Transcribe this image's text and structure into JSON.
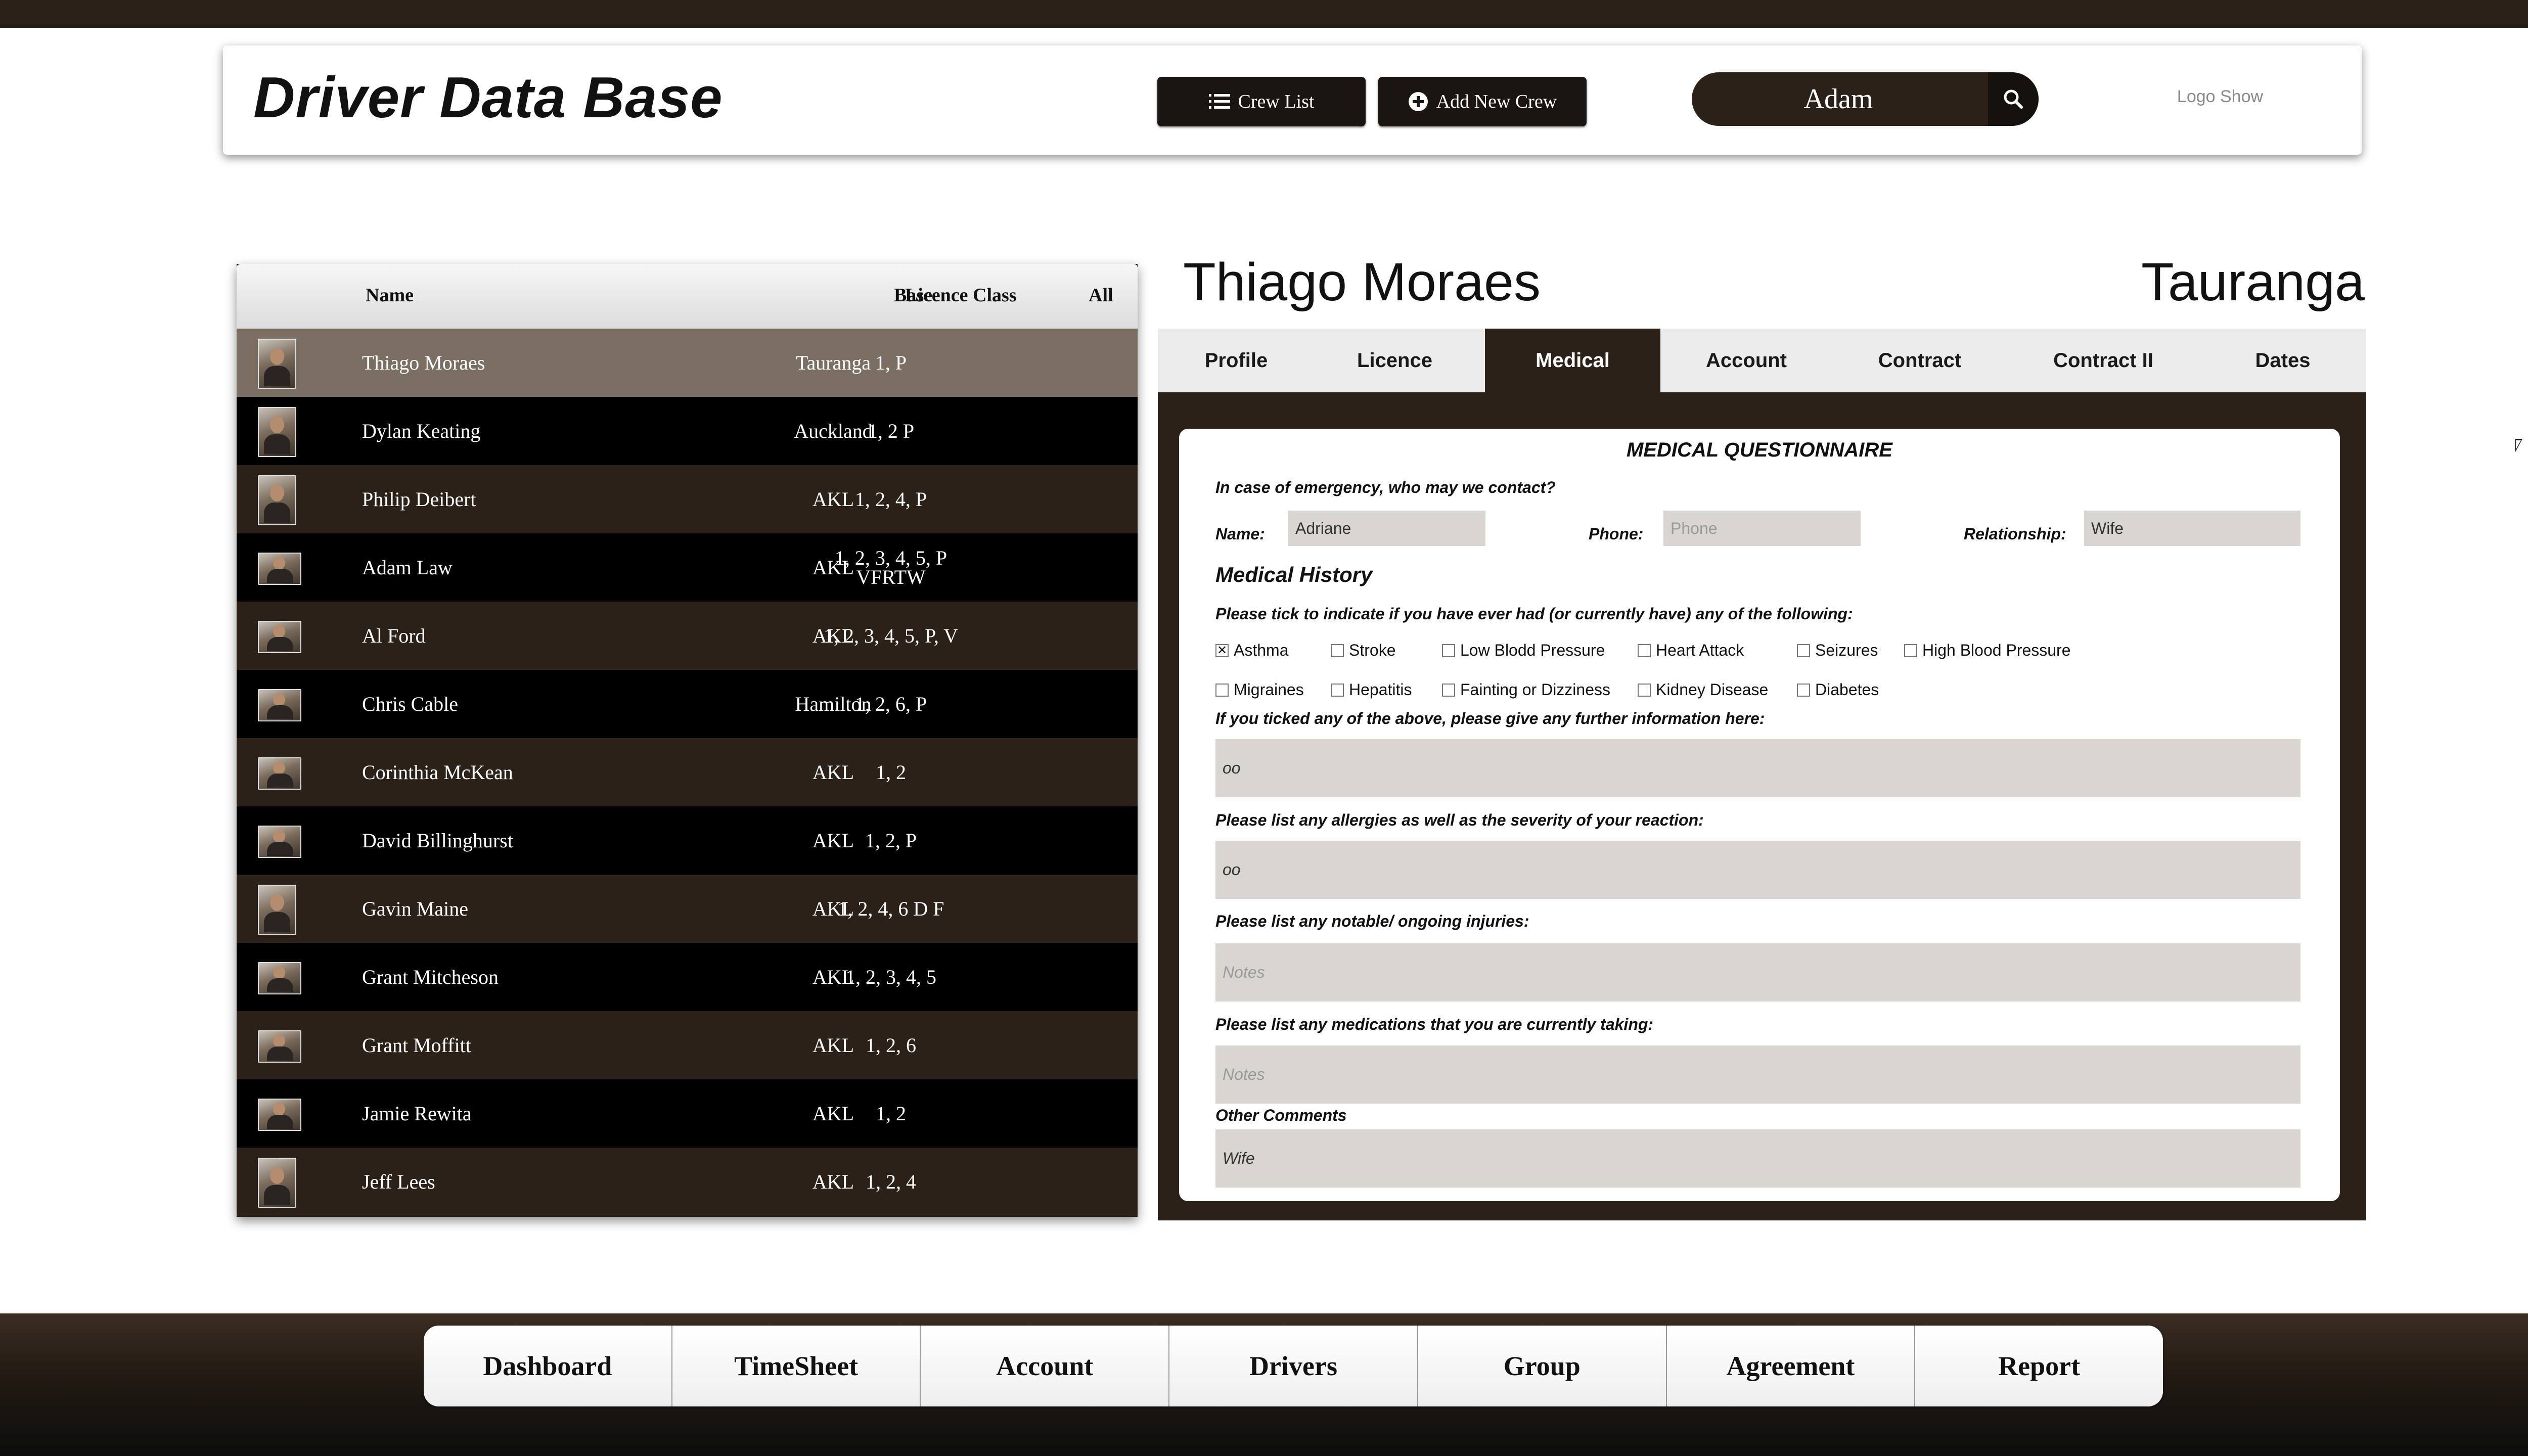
{
  "header": {
    "title": "Driver Data Base",
    "crew_list_label": "Crew List",
    "add_crew_label": "Add New Crew",
    "search_value": "Adam",
    "logo_text": "Logo Show"
  },
  "crew_table": {
    "columns": {
      "name": "Name",
      "base": "Base",
      "licence": "Licence Class",
      "all": "All"
    },
    "rows": [
      {
        "name": "Thiago Moraes",
        "base": "Tauranga",
        "licence": "1, P",
        "licence2": ""
      },
      {
        "name": "Dylan Keating",
        "base": "Auckland",
        "licence": "1, 2 P",
        "licence2": ""
      },
      {
        "name": "Philip Deibert",
        "base": "AKL",
        "licence": "1, 2, 4, P",
        "licence2": ""
      },
      {
        "name": "Adam Law",
        "base": "AKL",
        "licence": "1, 2, 3, 4, 5, P",
        "licence2": "VFRTW"
      },
      {
        "name": "Al Ford",
        "base": "AKL",
        "licence": "1, 2, 3, 4, 5, P, V",
        "licence2": ""
      },
      {
        "name": "Chris Cable",
        "base": "Hamilton",
        "licence": "1, 2, 6, P",
        "licence2": ""
      },
      {
        "name": "Corinthia McKean",
        "base": "AKL",
        "licence": "1, 2",
        "licence2": ""
      },
      {
        "name": "David Billinghurst",
        "base": "AKL",
        "licence": "1, 2, P",
        "licence2": ""
      },
      {
        "name": "Gavin Maine",
        "base": "AKL",
        "licence": "1, 2, 4, 6 D F",
        "licence2": ""
      },
      {
        "name": "Grant Mitcheson",
        "base": "AKL",
        "licence": "1, 2, 3, 4, 5",
        "licence2": ""
      },
      {
        "name": "Grant Moffitt",
        "base": "AKL",
        "licence": "1, 2, 6",
        "licence2": ""
      },
      {
        "name": "Jamie Rewita",
        "base": "AKL",
        "licence": "1, 2",
        "licence2": ""
      },
      {
        "name": "Jeff Lees",
        "base": "AKL",
        "licence": "1, 2, 4",
        "licence2": ""
      }
    ]
  },
  "detail": {
    "name": "Thiago Moraes",
    "base": "Tauranga",
    "tabs": [
      "Profile",
      "Licence",
      "Medical",
      "Account",
      "Contract",
      "Contract II",
      "Dates"
    ],
    "active_tab": "Medical"
  },
  "medical": {
    "title": "MEDICAL QUESTIONNAIRE",
    "emergency_prompt": "In case of emergency, who may we contact?",
    "name_label": "Name:",
    "name_value": "Adriane",
    "phone_label": "Phone:",
    "phone_placeholder": "Phone",
    "relationship_label": "Relationship:",
    "relationship_value": "Wife",
    "history_title": "Medical History",
    "tick_prompt": "Please tick to indicate if you have ever had (or currently have) any of the following:",
    "conditions": [
      {
        "label": "Asthma",
        "checked": "✕"
      },
      {
        "label": "Stroke",
        "checked": ""
      },
      {
        "label": "Low Blodd Pressure",
        "checked": ""
      },
      {
        "label": "Heart Attack",
        "checked": ""
      },
      {
        "label": "Seizures",
        "checked": ""
      },
      {
        "label": "High Blood Pressure",
        "checked": ""
      },
      {
        "label": "Migraines",
        "checked": ""
      },
      {
        "label": "Hepatitis",
        "checked": ""
      },
      {
        "label": "Fainting or Dizziness",
        "checked": ""
      },
      {
        "label": "Kidney Disease",
        "checked": ""
      },
      {
        "label": "Diabetes",
        "checked": ""
      }
    ],
    "further_info_prompt": "If you ticked any of the above, please give any further information here:",
    "further_info_value": "oo",
    "allergies_prompt": "Please list any allergies as well as the severity of your reaction:",
    "allergies_value": "oo",
    "injuries_prompt": "Please list any notable/ ongoing injuries:",
    "injuries_placeholder": "Notes",
    "medications_prompt": "Please list any medications that you are currently taking:",
    "medications_placeholder": "Notes",
    "comments_label": "Other Comments",
    "comments_value": "Wife"
  },
  "bottom_nav": [
    "Dashboard",
    "TimeSheet",
    "Account",
    "Drivers",
    "Group",
    "Agreement",
    "Report"
  ],
  "colors": {
    "dark_brown": "#2b2118",
    "selected_row": "#7b6e62",
    "field_gray": "#d9d6d2"
  }
}
